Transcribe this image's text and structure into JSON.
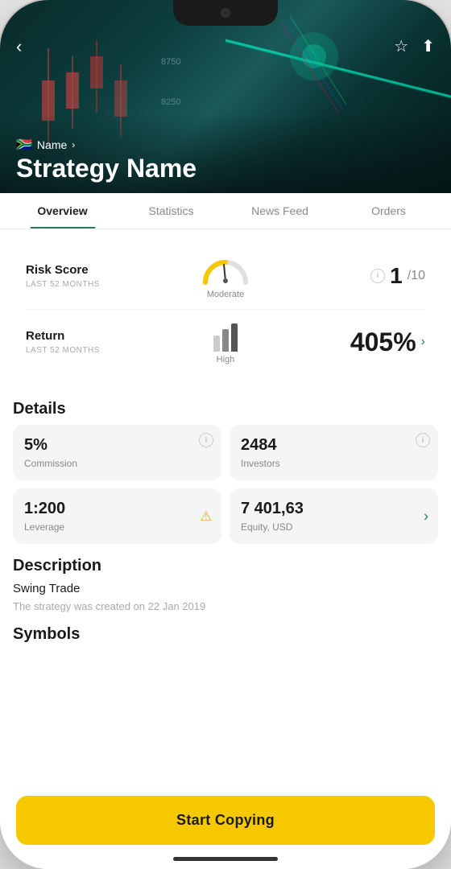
{
  "header": {
    "back_label": "‹",
    "name": "Name",
    "name_chevron": "›",
    "title": "Strategy Name",
    "flag": "🇿🇦"
  },
  "tabs": [
    {
      "id": "overview",
      "label": "Overview",
      "active": true
    },
    {
      "id": "statistics",
      "label": "Statistics",
      "active": false
    },
    {
      "id": "newsfeed",
      "label": "News Feed",
      "active": false
    },
    {
      "id": "orders",
      "label": "Orders",
      "active": false
    }
  ],
  "risk_card": {
    "label": "Risk Score",
    "sublabel": "LAST 52 MONTHS",
    "gauge_label": "Moderate",
    "value": "1",
    "value_suffix": "/10"
  },
  "return_card": {
    "label": "Return",
    "sublabel": "LAST 52 MONTHS",
    "bar_label": "High",
    "value": "405%"
  },
  "details": {
    "section_title": "Details",
    "items": [
      {
        "id": "commission",
        "value": "5%",
        "label": "Commission",
        "has_info": true,
        "has_warning": false,
        "has_chevron": false
      },
      {
        "id": "investors",
        "value": "2484",
        "label": "Investors",
        "has_info": true,
        "has_warning": false,
        "has_chevron": false
      },
      {
        "id": "leverage",
        "value": "1:200",
        "label": "Leverage",
        "has_info": false,
        "has_warning": true,
        "has_chevron": false
      },
      {
        "id": "equity",
        "value": "7 401,63",
        "label": "Equity, USD",
        "has_info": false,
        "has_warning": false,
        "has_chevron": true
      }
    ]
  },
  "description": {
    "section_title": "Description",
    "main_text": "Swing Trade",
    "sub_text": "The strategy was created on 22 Jan 2019"
  },
  "symbols": {
    "section_title": "Symbols"
  },
  "cta": {
    "label": "Start Copying"
  },
  "bars": [
    {
      "height": 20,
      "color": "#cccccc"
    },
    {
      "height": 28,
      "color": "#888888"
    },
    {
      "height": 35,
      "color": "#555555"
    }
  ]
}
